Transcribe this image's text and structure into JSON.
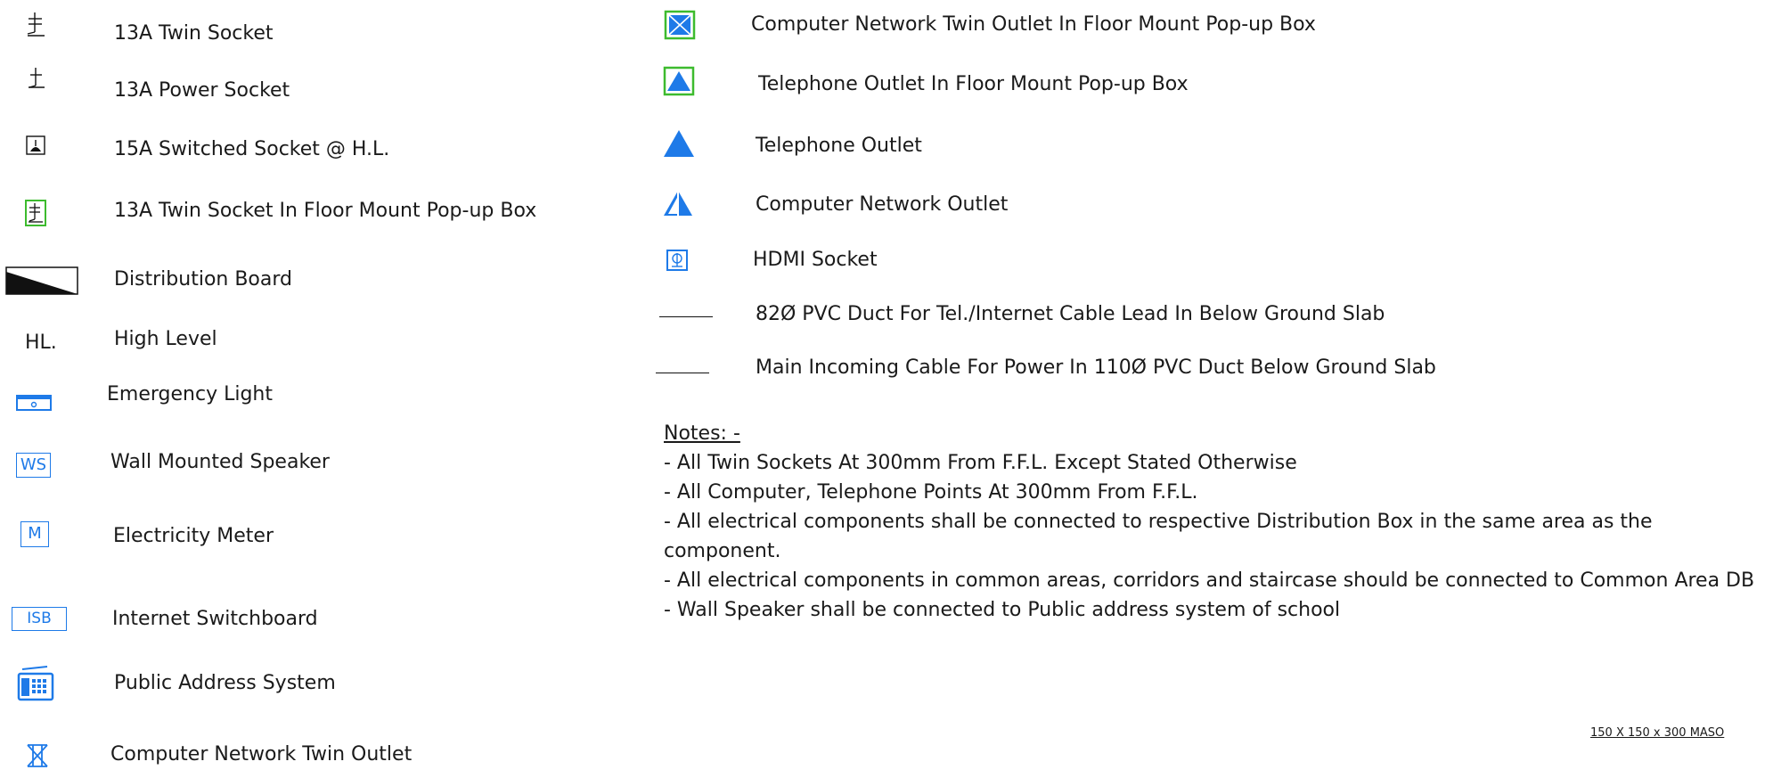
{
  "legend_left": [
    {
      "icon": "twin-socket-icon",
      "label": "13A Twin Socket"
    },
    {
      "icon": "power-socket-icon",
      "label": "13A Power Socket"
    },
    {
      "icon": "switched-socket-icon",
      "label": "15A Switched Socket @ H.L."
    },
    {
      "icon": "floor-twin-socket-icon",
      "label": "13A Twin Socket In Floor Mount Pop-up Box"
    },
    {
      "icon": "distribution-board-icon",
      "label": "Distribution Board"
    },
    {
      "icon": "high-level-icon",
      "label": "High Level",
      "symbol_text": "HL."
    },
    {
      "icon": "emergency-light-icon",
      "label": "Emergency Light"
    },
    {
      "icon": "wall-speaker-icon",
      "label": "Wall Mounted Speaker",
      "symbol_text": "WS"
    },
    {
      "icon": "electricity-meter-icon",
      "label": "Electricity Meter",
      "symbol_text": "M"
    },
    {
      "icon": "internet-switchboard-icon",
      "label": "Internet Switchboard",
      "symbol_text": "ISB"
    },
    {
      "icon": "public-address-icon",
      "label": "Public Address System"
    },
    {
      "icon": "network-twin-outlet-icon",
      "label": "Computer Network Twin Outlet"
    }
  ],
  "legend_right": [
    {
      "icon": "floor-network-twin-outlet-icon",
      "label": "Computer Network Twin Outlet In Floor Mount Pop-up Box"
    },
    {
      "icon": "floor-telephone-outlet-icon",
      "label": "Telephone Outlet In Floor Mount Pop-up Box"
    },
    {
      "icon": "telephone-outlet-icon",
      "label": "Telephone Outlet"
    },
    {
      "icon": "network-outlet-icon",
      "label": "Computer Network Outlet"
    },
    {
      "icon": "hdmi-socket-icon",
      "label": "HDMI Socket"
    },
    {
      "icon": "duct-line-icon",
      "label": "82Ø PVC Duct For Tel./Internet Cable Lead In Below Ground Slab"
    },
    {
      "icon": "cable-line-icon",
      "label": "Main Incoming Cable For Power In 110Ø PVC Duct Below Ground Slab"
    }
  ],
  "notes": {
    "heading": "Notes: -",
    "items": [
      "- All Twin Sockets At 300mm From F.F.L. Except Stated Otherwise",
      "- All Computer, Telephone Points At 300mm From F.F.L.",
      "- All electrical components shall be connected to respective Distribution Box in the same area as the component.",
      "- All electrical components in common areas, corridors and staircase should be connected to Common Area DB",
      "- Wall Speaker shall be connected to Public address system of school"
    ]
  },
  "scale_note": "150 X 150 x 300 MASO",
  "colors": {
    "blue": "#1e7ae8",
    "green": "#3dbb2e",
    "black": "#111111"
  }
}
